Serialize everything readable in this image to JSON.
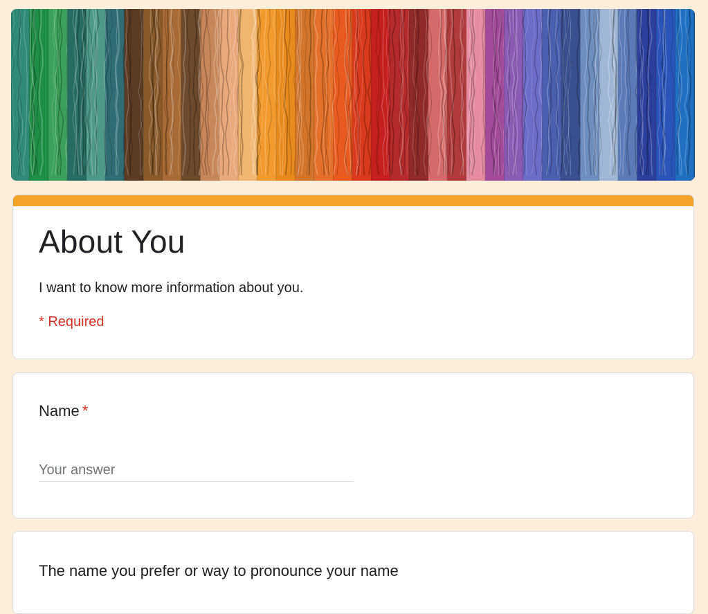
{
  "header": {
    "banner_colors": [
      "#2f8a78",
      "#1f8f47",
      "#3aa05a",
      "#276c63",
      "#4e9a8a",
      "#2f6c73",
      "#5b3b24",
      "#8a5a2b",
      "#a86b35",
      "#6e4a2c",
      "#c7875a",
      "#e9a97c",
      "#f0b56f",
      "#f29a2e",
      "#e98a1c",
      "#d2742a",
      "#e4702a",
      "#e85a1f",
      "#d93a1b",
      "#c5201f",
      "#b52a2a",
      "#8f2a2a",
      "#d66a6a",
      "#b13a3a",
      "#e78ca0",
      "#a44a9b",
      "#8a5bb5",
      "#6c6cc9",
      "#4b5fb0",
      "#3a4f8f",
      "#6c8fc0",
      "#9fb6d6",
      "#5a7ab8",
      "#2d3f9c",
      "#2a54b9",
      "#1f6fc2"
    ]
  },
  "form": {
    "accent_color": "#f4a228",
    "title": "About You",
    "description": "I want to know more information about you.",
    "required_note": "* Required"
  },
  "questions": [
    {
      "label": "Name",
      "required_marker": "*",
      "placeholder": "Your answer"
    },
    {
      "label": "The name you prefer or way to pronounce your name"
    }
  ]
}
